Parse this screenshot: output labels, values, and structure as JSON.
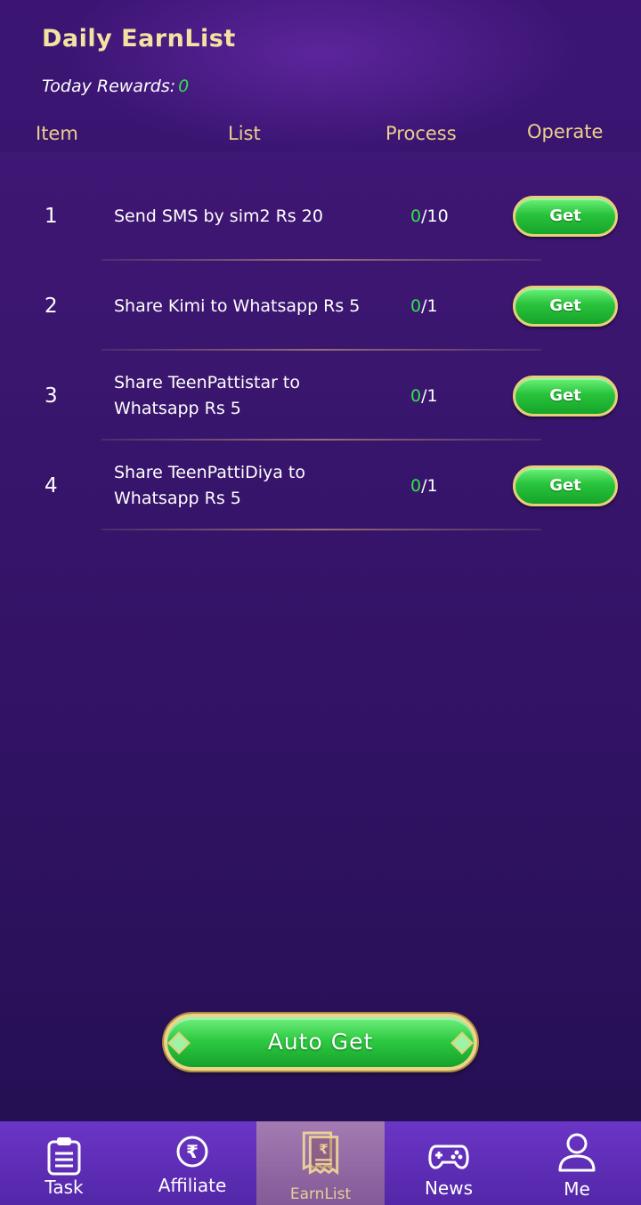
{
  "header": {
    "title": "Daily EarnList",
    "rewards_label": "Today Rewards:",
    "rewards_value": "0",
    "columns": {
      "item": "Item",
      "list": "List",
      "process": "Process",
      "operate": "Operate"
    }
  },
  "tasks": [
    {
      "num": "1",
      "desc": "Send SMS by sim2 Rs 20",
      "done": "0",
      "total": "/10",
      "button": "Get"
    },
    {
      "num": "2",
      "desc": "Share Kimi to Whatsapp Rs 5",
      "done": "0",
      "total": "/1",
      "button": "Get"
    },
    {
      "num": "3",
      "desc": "Share TeenPattistar to Whatsapp Rs 5",
      "done": "0",
      "total": "/1",
      "button": "Get"
    },
    {
      "num": "4",
      "desc": "Share TeenPattiDiya to Whatsapp Rs 5",
      "done": "0",
      "total": "/1",
      "button": "Get"
    }
  ],
  "auto_get": "Auto Get",
  "tabs": [
    {
      "label": "Task",
      "icon": "clipboard-icon"
    },
    {
      "label": "Affiliate",
      "icon": "rupee-coin-icon"
    },
    {
      "label": "EarnList",
      "icon": "receipt-icon",
      "active": true
    },
    {
      "label": "News",
      "icon": "gamepad-icon"
    },
    {
      "label": "Me",
      "icon": "user-icon"
    }
  ],
  "colors": {
    "accent_gold": "#eccf8a",
    "green": "#2ee34a",
    "background": "#2c1160"
  }
}
